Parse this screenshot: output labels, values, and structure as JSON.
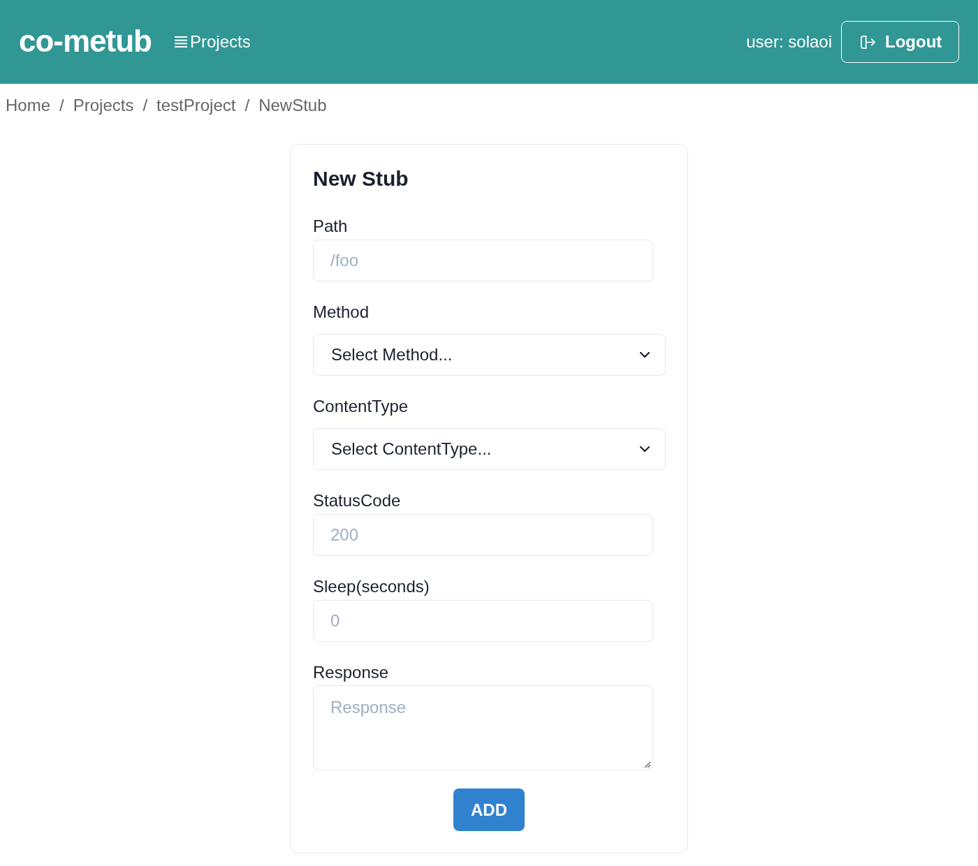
{
  "header": {
    "logo": "co-metub",
    "nav": [
      {
        "label": "Projects"
      }
    ],
    "user": "user: solaoi",
    "logout_button": "Logout"
  },
  "breadcrumb": [
    {
      "kind": "link",
      "text": "Home"
    },
    {
      "kind": "separator",
      "text": "/"
    },
    {
      "kind": "link",
      "text": "Projects"
    },
    {
      "kind": "separator",
      "text": "/"
    },
    {
      "kind": "link",
      "text": "testProject"
    },
    {
      "kind": "separator",
      "text": "/"
    },
    {
      "kind": "link",
      "text": "NewStub"
    }
  ],
  "form": {
    "title": "New Stub",
    "fields": [
      {
        "kind": "input",
        "label": "Path",
        "placeholder": "/foo"
      },
      {
        "kind": "select",
        "label": "Method",
        "value": "Select Method..."
      },
      {
        "kind": "select",
        "label": "ContentType",
        "value": "Select ContentType..."
      },
      {
        "kind": "input",
        "label": "StatusCode",
        "placeholder": "200"
      },
      {
        "kind": "input",
        "label": "Sleep(seconds)",
        "placeholder": "0"
      },
      {
        "kind": "textarea",
        "label": "Response",
        "placeholder": "Response"
      }
    ],
    "submit_button": "ADD"
  }
}
